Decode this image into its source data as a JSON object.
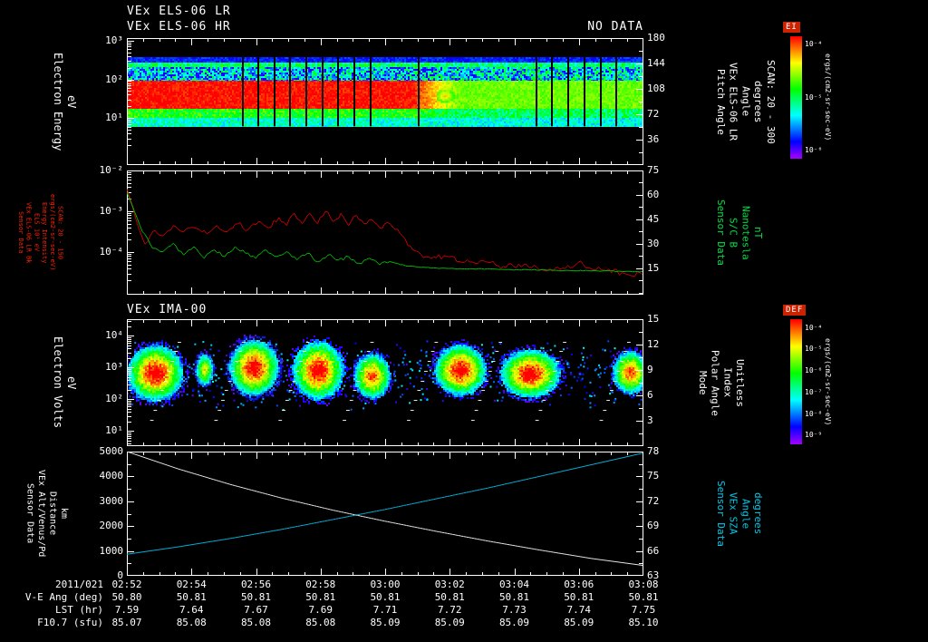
{
  "header": {
    "no_data": "NO DATA",
    "date_label": "2011/021"
  },
  "colors": {
    "background": "#000000",
    "frame": "#ffffff",
    "els_line": "#cc0000",
    "b_line": "#00bb00",
    "alt_line": "#e8e8e8",
    "sza_line": "#00b4dc",
    "red_label": "#ff2200",
    "green_label": "#00dd44",
    "cyan_label": "#00c8e8",
    "bar_title_bg": "#cc2200"
  },
  "time_axis": {
    "ticks": [
      "02:52",
      "02:54",
      "02:56",
      "02:58",
      "03:00",
      "03:02",
      "03:04",
      "03:06",
      "03:08"
    ]
  },
  "table": {
    "rows": [
      {
        "label": "V-E Ang (deg)",
        "values": [
          "50.80",
          "50.81",
          "50.81",
          "50.81",
          "50.81",
          "50.81",
          "50.81",
          "50.81",
          "50.81"
        ]
      },
      {
        "label": "LST (hr)",
        "values": [
          "7.59",
          "7.64",
          "7.67",
          "7.69",
          "7.71",
          "7.72",
          "7.73",
          "7.74",
          "7.75"
        ]
      },
      {
        "label": "F10.7 (sfu)",
        "values": [
          "85.07",
          "85.08",
          "85.08",
          "85.08",
          "85.09",
          "85.09",
          "85.09",
          "85.09",
          "85.10"
        ]
      }
    ]
  },
  "chart_data": [
    {
      "id": "els_pitch_angle_spectrogram",
      "type": "heatmap",
      "title": "VEx ELS-06 LR",
      "subtitle": "VEx ELS-06 HR",
      "ylabel_lines": [
        "Electron Energy",
        "eV"
      ],
      "left_ticks": [
        {
          "label": "10³",
          "frac": 0.02
        },
        {
          "label": "10²",
          "frac": 0.325
        },
        {
          "label": "10¹",
          "frac": 0.63
        }
      ],
      "right_ticks": [
        {
          "label": "180",
          "frac": 0.0
        },
        {
          "label": "144",
          "frac": 0.2
        },
        {
          "label": "108",
          "frac": 0.4
        },
        {
          "label": "72",
          "frac": 0.6
        },
        {
          "label": "36",
          "frac": 0.8
        }
      ],
      "right_label_lines": [
        "Pitch Angle",
        "VEx ELS-06 LR",
        "Angle",
        "degrees",
        "SCAN: 20 - 300"
      ],
      "x_start": "02:52",
      "x_end": "03:08",
      "strip": {
        "top_frac": 0.15,
        "bottom_frac": 0.695
      },
      "transition_frac": 0.55,
      "rows": [
        {
          "f0": 0.0,
          "f1": 0.08,
          "v": 0.17,
          "vl": 0.17,
          "n": 0.05
        },
        {
          "f0": 0.08,
          "f1": 0.15,
          "v": 0.5,
          "vl": 0.47,
          "n": 0.12
        },
        {
          "f0": 0.15,
          "f1": 0.35,
          "v": 0.32,
          "vl": 0.36,
          "n": 0.24
        },
        {
          "f0": 0.35,
          "f1": 0.75,
          "v": 0.99,
          "vl": 0.66,
          "n": 0.05
        },
        {
          "f0": 0.75,
          "f1": 0.88,
          "v": 0.58,
          "vl": 0.5,
          "n": 0.1
        },
        {
          "f0": 0.88,
          "f1": 1.0,
          "v": 0.4,
          "vl": 0.38,
          "n": 0.09
        }
      ],
      "hotspots": [
        {
          "t": 0.615,
          "yf": 0.55,
          "rt": 0.018,
          "ryf": 0.1,
          "v": 0.85
        }
      ],
      "gaps": [
        0.225,
        0.254,
        0.286,
        0.316,
        0.347,
        0.379,
        0.409,
        0.44,
        0.472,
        0.565,
        0.793,
        0.823,
        0.854,
        0.886,
        0.918,
        0.947
      ],
      "colorbar": {
        "title": "EI",
        "tick_labels": [
          "10⁻⁴",
          "10⁻⁵",
          "10⁻⁶"
        ],
        "units": "ergs/(cm2-sr-sec-eV)"
      }
    },
    {
      "id": "els_intensity_and_b_field",
      "type": "line",
      "left_label_lines": [
        "Sensor Data",
        "VEx ELS-06 LR Bk",
        "ELS 10¹ eV",
        "Energy Intensity",
        "ergs/(cm2-sr-sec-eV)",
        "SCAN: 20 - 150"
      ],
      "left_ticks": [
        {
          "label": "10⁻²",
          "frac": 0.0
        },
        {
          "label": "10⁻³",
          "frac": 0.328
        },
        {
          "label": "10⁻⁴",
          "frac": 0.657
        }
      ],
      "right_ticks": [
        {
          "label": "75",
          "frac": 0.0
        },
        {
          "label": "60",
          "frac": 0.197
        },
        {
          "label": "45",
          "frac": 0.394
        },
        {
          "label": "30",
          "frac": 0.591
        },
        {
          "label": "15",
          "frac": 0.788
        }
      ],
      "right_label_lines": [
        "Sensor Data",
        "S/C B",
        "Nanotesla",
        "nT"
      ],
      "left_axis": {
        "top_log": -2,
        "decades_per_height": 3.04
      },
      "right_axis": {
        "top": 75,
        "bottom": 0
      },
      "series": [
        {
          "name": "ELS Energy Intensity",
          "color": "#cc0000",
          "axis": "log-left",
          "jitter": 3,
          "points": [
            [
              0,
              -2.45
            ],
            [
              0.008,
              -2.75
            ],
            [
              0.02,
              -3.3
            ],
            [
              0.035,
              -3.8
            ],
            [
              0.05,
              -3.5
            ],
            [
              0.07,
              -3.6
            ],
            [
              0.09,
              -3.35
            ],
            [
              0.11,
              -3.5
            ],
            [
              0.13,
              -3.4
            ],
            [
              0.155,
              -3.55
            ],
            [
              0.175,
              -3.35
            ],
            [
              0.195,
              -3.5
            ],
            [
              0.215,
              -3.3
            ],
            [
              0.235,
              -3.45
            ],
            [
              0.255,
              -3.25
            ],
            [
              0.275,
              -3.4
            ],
            [
              0.295,
              -3.15
            ],
            [
              0.31,
              -3.35
            ],
            [
              0.325,
              -3.05
            ],
            [
              0.34,
              -3.3
            ],
            [
              0.355,
              -3.05
            ],
            [
              0.37,
              -3.3
            ],
            [
              0.385,
              -3.0
            ],
            [
              0.4,
              -3.25
            ],
            [
              0.415,
              -3.05
            ],
            [
              0.43,
              -3.35
            ],
            [
              0.445,
              -3.1
            ],
            [
              0.46,
              -3.3
            ],
            [
              0.475,
              -3.2
            ],
            [
              0.49,
              -3.4
            ],
            [
              0.51,
              -3.3
            ],
            [
              0.53,
              -3.55
            ],
            [
              0.55,
              -3.85
            ],
            [
              0.57,
              -4.05
            ],
            [
              0.59,
              -4.15
            ],
            [
              0.62,
              -4.1
            ],
            [
              0.65,
              -4.25
            ],
            [
              0.69,
              -4.2
            ],
            [
              0.73,
              -4.35
            ],
            [
              0.77,
              -4.3
            ],
            [
              0.81,
              -4.45
            ],
            [
              0.85,
              -4.4
            ],
            [
              0.875,
              -4.25
            ],
            [
              0.9,
              -4.4
            ],
            [
              0.93,
              -4.45
            ],
            [
              0.96,
              -4.5
            ],
            [
              1,
              -4.55
            ]
          ]
        },
        {
          "name": "S/C B",
          "color": "#00bb00",
          "axis": "right",
          "jitter": 2,
          "jitter_end_frac": 0.5,
          "points": [
            [
              0,
              62
            ],
            [
              0.015,
              50
            ],
            [
              0.03,
              38
            ],
            [
              0.05,
              28
            ],
            [
              0.07,
              26
            ],
            [
              0.09,
              31
            ],
            [
              0.11,
              24
            ],
            [
              0.13,
              29
            ],
            [
              0.15,
              22
            ],
            [
              0.17,
              27
            ],
            [
              0.19,
              23
            ],
            [
              0.21,
              29
            ],
            [
              0.23,
              25
            ],
            [
              0.25,
              22
            ],
            [
              0.27,
              27
            ],
            [
              0.29,
              23
            ],
            [
              0.31,
              26
            ],
            [
              0.33,
              21
            ],
            [
              0.35,
              25
            ],
            [
              0.37,
              20
            ],
            [
              0.39,
              24
            ],
            [
              0.41,
              21
            ],
            [
              0.43,
              23
            ],
            [
              0.45,
              19
            ],
            [
              0.47,
              22
            ],
            [
              0.49,
              18
            ],
            [
              0.51,
              20
            ],
            [
              0.54,
              17.5
            ],
            [
              0.57,
              16.5
            ],
            [
              0.61,
              16
            ],
            [
              0.66,
              15.5
            ],
            [
              0.71,
              15.5
            ],
            [
              0.76,
              15
            ],
            [
              0.81,
              15
            ],
            [
              0.86,
              14.5
            ],
            [
              0.91,
              14.5
            ],
            [
              0.96,
              14
            ],
            [
              1,
              14
            ]
          ]
        }
      ]
    },
    {
      "id": "ima_ion_spectrogram",
      "type": "heatmap",
      "title": "VEx IMA-00",
      "ylabel_lines": [
        "Electron Volts",
        "eV"
      ],
      "left_ticks": [
        {
          "label": "10⁴",
          "frac": 0.13
        },
        {
          "label": "10³",
          "frac": 0.38
        },
        {
          "label": "10²",
          "frac": 0.63
        },
        {
          "label": "10¹",
          "frac": 0.88
        }
      ],
      "right_ticks": [
        {
          "label": "15",
          "frac": 0.0
        },
        {
          "label": "12",
          "frac": 0.2
        },
        {
          "label": "9",
          "frac": 0.4
        },
        {
          "label": "6",
          "frac": 0.6
        },
        {
          "label": "3",
          "frac": 0.8
        }
      ],
      "right_label_lines": [
        "Mode",
        "Polar Angle",
        "Index",
        "Unitless"
      ],
      "blobs": [
        {
          "cx": 0.055,
          "cy": 0.42,
          "rx": 0.055,
          "ry": 0.22,
          "v": 1.0
        },
        {
          "cx": 0.15,
          "cy": 0.4,
          "rx": 0.018,
          "ry": 0.13,
          "v": 0.75
        },
        {
          "cx": 0.245,
          "cy": 0.38,
          "rx": 0.048,
          "ry": 0.22,
          "v": 1.0
        },
        {
          "cx": 0.37,
          "cy": 0.4,
          "rx": 0.05,
          "ry": 0.23,
          "v": 1.0
        },
        {
          "cx": 0.475,
          "cy": 0.45,
          "rx": 0.036,
          "ry": 0.18,
          "v": 0.9
        },
        {
          "cx": 0.645,
          "cy": 0.4,
          "rx": 0.05,
          "ry": 0.2,
          "v": 1.0
        },
        {
          "cx": 0.78,
          "cy": 0.43,
          "rx": 0.058,
          "ry": 0.19,
          "v": 1.0
        },
        {
          "cx": 0.975,
          "cy": 0.42,
          "rx": 0.035,
          "ry": 0.17,
          "v": 0.9
        }
      ],
      "stairs": {
        "count": 8,
        "x0_frac": 0.045,
        "period_frac": 0.1243,
        "width_frac": 0.06,
        "y_top_frac": 0.1,
        "y_bottom_frac": 0.79,
        "steps": 9
      },
      "speckle": {
        "count": 700,
        "y0_frac": 0.16,
        "y1_frac": 0.72
      },
      "colorbar": {
        "title": "DEF",
        "tick_labels": [
          "10⁻⁴",
          "10⁻⁵",
          "10⁻⁶",
          "10⁻⁷",
          "10⁻⁸",
          "10⁻⁹"
        ],
        "units": "ergs/(cm2-sr-sec-eV)"
      }
    },
    {
      "id": "altitude_and_sza",
      "type": "line",
      "left_label_lines": [
        "Sensor Data",
        "VEx Alt/Venus/Pd",
        "Distance",
        "km"
      ],
      "left_ticks": [
        {
          "label": "5000",
          "frac": 0.0
        },
        {
          "label": "4000",
          "frac": 0.2
        },
        {
          "label": "3000",
          "frac": 0.4
        },
        {
          "label": "2000",
          "frac": 0.6
        },
        {
          "label": "1000",
          "frac": 0.8
        },
        {
          "label": "0",
          "frac": 1.0
        }
      ],
      "right_ticks": [
        {
          "label": "78",
          "frac": 0.0
        },
        {
          "label": "75",
          "frac": 0.2
        },
        {
          "label": "72",
          "frac": 0.4
        },
        {
          "label": "69",
          "frac": 0.6
        },
        {
          "label": "66",
          "frac": 0.8
        },
        {
          "label": "63",
          "frac": 1.0
        }
      ],
      "right_label_lines": [
        "Sensor Data",
        "VEx SZA",
        "Angle",
        "degrees"
      ],
      "left_axis": {
        "top": 5000,
        "bottom": 0
      },
      "right_axis": {
        "top": 78,
        "bottom": 63
      },
      "series": [
        {
          "name": "VEx Altitude",
          "color": "#e8e8e8",
          "axis": "left",
          "points": [
            [
              0,
              5000
            ],
            [
              0.1,
              4300
            ],
            [
              0.2,
              3680
            ],
            [
              0.3,
              3130
            ],
            [
              0.4,
              2640
            ],
            [
              0.5,
              2200
            ],
            [
              0.6,
              1790
            ],
            [
              0.7,
              1400
            ],
            [
              0.8,
              1040
            ],
            [
              0.9,
              700
            ],
            [
              1,
              420
            ]
          ]
        },
        {
          "name": "VEx SZA",
          "color": "#00b4dc",
          "axis": "right",
          "points": [
            [
              0,
              65.6
            ],
            [
              0.1,
              66.5
            ],
            [
              0.2,
              67.5
            ],
            [
              0.3,
              68.6
            ],
            [
              0.4,
              69.8
            ],
            [
              0.5,
              71.0
            ],
            [
              0.6,
              72.3
            ],
            [
              0.7,
              73.6
            ],
            [
              0.8,
              75.0
            ],
            [
              0.9,
              76.4
            ],
            [
              1,
              77.8
            ]
          ]
        }
      ]
    }
  ]
}
